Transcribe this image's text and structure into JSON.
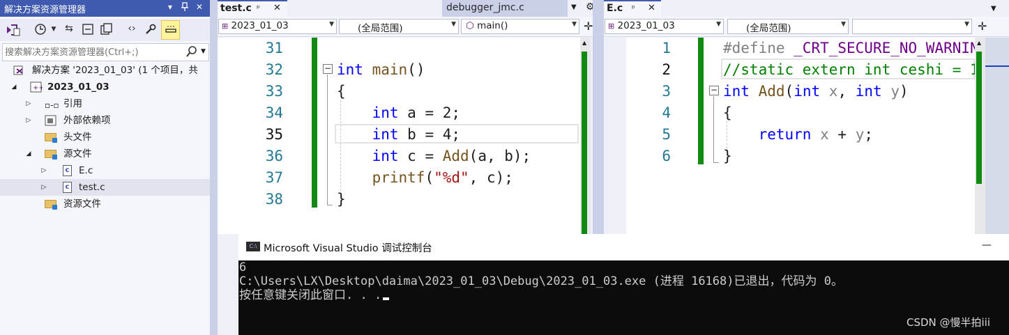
{
  "solution_explorer": {
    "title": "解决方案资源管理器",
    "header_buttons": [
      "▾",
      "ᵖ",
      "✕"
    ],
    "search_placeholder": "搜索解决方案资源管理器(Ctrl+;)",
    "tree": [
      {
        "label": "解决方案 '2023_01_03' (1 个项目，共",
        "icon": "solution-icon"
      },
      {
        "label": "2023_01_03",
        "icon": "project-icon"
      },
      {
        "label": "引用",
        "icon": "references-icon"
      },
      {
        "label": "外部依赖项",
        "icon": "external-deps-icon"
      },
      {
        "label": "头文件",
        "icon": "filter-folder-icon"
      },
      {
        "label": "源文件",
        "icon": "filter-folder-icon"
      },
      {
        "label": "E.c",
        "icon": "c-file-icon"
      },
      {
        "label": "test.c",
        "icon": "c-file-icon"
      },
      {
        "label": "资源文件",
        "icon": "filter-folder-icon"
      }
    ]
  },
  "left_editor": {
    "tab_active": "test.c",
    "tab_inactive": "debugger_jmc.c",
    "nav": {
      "project": "2023_01_03",
      "scope": "(全局范围)",
      "member": "main()"
    },
    "line_numbers": [
      "31",
      "32",
      "33",
      "34",
      "35",
      "36",
      "37",
      "38"
    ]
  },
  "right_editor": {
    "tab_active": "E.c",
    "nav": {
      "project": "2023_01_03",
      "scope": "(全局范围)",
      "member": ""
    },
    "line_numbers": [
      "1",
      "2",
      "3",
      "4",
      "5",
      "6"
    ]
  },
  "console": {
    "title": "Microsoft Visual Studio 调试控制台",
    "minimize": "—",
    "lines": [
      "6",
      "C:\\Users\\LX\\Desktop\\daima\\2023_01_03\\Debug\\2023_01_03.exe (进程 16168)已退出，代码为 0。",
      "按任意键关闭此窗口. . ."
    ]
  },
  "watermark": "CSDN @慢半拍iii",
  "colors": {
    "accent": "#3F5AAE",
    "keyword": "#0000FF",
    "string": "#A31515",
    "comment": "#008000",
    "macro": "#6F008A",
    "change_bar": "#108A10",
    "line_number": "#237893"
  }
}
